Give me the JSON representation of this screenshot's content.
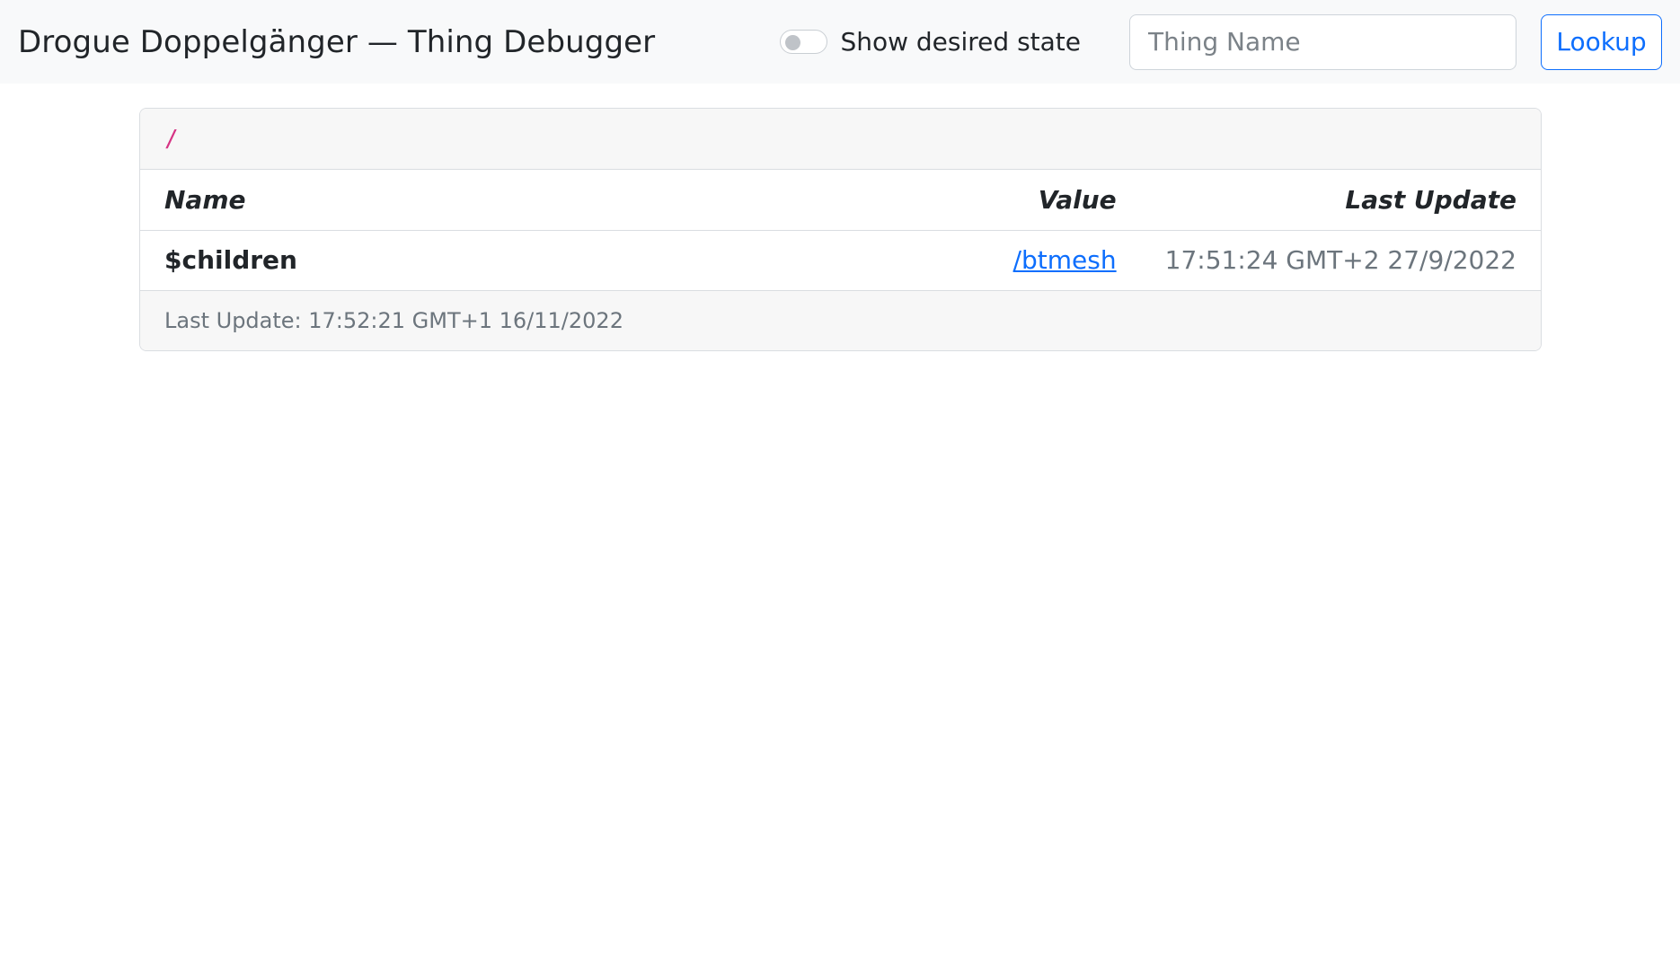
{
  "navbar": {
    "brand": "Drogue Doppelgänger — Thing Debugger",
    "toggle_label": "Show desired state",
    "toggle_on": false,
    "search_placeholder": "Thing Name",
    "search_value": "",
    "lookup_label": "Lookup"
  },
  "card": {
    "path": "/",
    "columns": {
      "name": "Name",
      "value": "Value",
      "last_update": "Last Update"
    },
    "rows": [
      {
        "name": "$children",
        "value": "/btmesh",
        "last_update": "17:51:24 GMT+2 27/9/2022"
      }
    ],
    "footer": "Last Update: 17:52:21 GMT+1 16/11/2022"
  },
  "colors": {
    "accent": "#0d6efd",
    "path": "#d63384",
    "muted": "#6c757d"
  }
}
